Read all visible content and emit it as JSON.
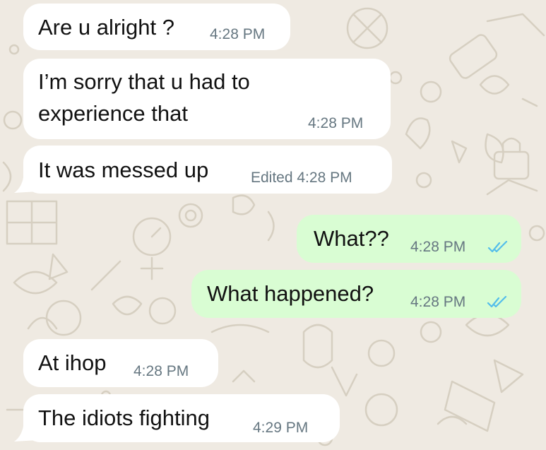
{
  "messages": [
    {
      "text": "Are u alright ?",
      "time": "4:28 PM",
      "direction": "incoming"
    },
    {
      "text_lines": [
        "I’m sorry that u had to",
        "experience that"
      ],
      "time": "4:28 PM",
      "direction": "incoming"
    },
    {
      "text": "It was messed up",
      "meta": "Edited 4:28 PM",
      "direction": "incoming"
    },
    {
      "text": "What??",
      "time": "4:28 PM",
      "direction": "outgoing",
      "status_icon": "double-check-read-icon"
    },
    {
      "text": "What happened?",
      "time": "4:28 PM",
      "direction": "outgoing",
      "status_icon": "double-check-read-icon"
    },
    {
      "text": "At ihop",
      "time": "4:28 PM",
      "direction": "incoming"
    },
    {
      "text": "The idiots fighting",
      "time": "4:29 PM",
      "direction": "incoming"
    }
  ],
  "colors": {
    "background": "#efeae2",
    "incoming_bubble": "#ffffff",
    "outgoing_bubble": "#d9fdd3",
    "read_ticks": "#53bdeb",
    "meta_text": "#667781"
  }
}
